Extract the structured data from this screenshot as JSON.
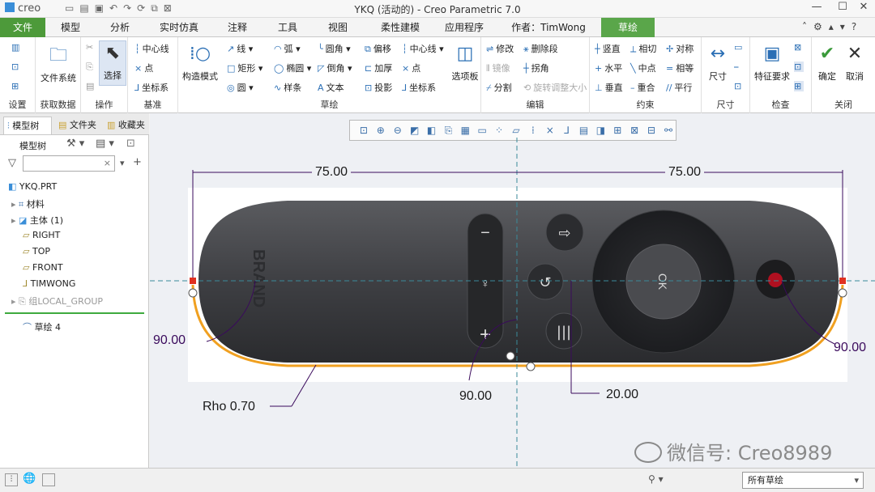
{
  "titlebar": {
    "logo": "creo",
    "title": "YKQ (活动的) - Creo Parametric 7.0",
    "minimize": "—",
    "restore": "☐",
    "close": "✕"
  },
  "tabs": [
    {
      "label": "文件"
    },
    {
      "label": "模型"
    },
    {
      "label": "分析"
    },
    {
      "label": "实时仿真"
    },
    {
      "label": "注释"
    },
    {
      "label": "工具"
    },
    {
      "label": "视图"
    },
    {
      "label": "柔性建模"
    },
    {
      "label": "应用程序"
    },
    {
      "label": "作者：TimWong"
    },
    {
      "label": "草绘"
    }
  ],
  "ribbon": {
    "setup": {
      "label": "设置"
    },
    "get_data": {
      "file_system": "文件系统",
      "label": "获取数据"
    },
    "operations": {
      "select": "选择",
      "label": "操作"
    },
    "datum": {
      "centerline": "中心线",
      "point": "点",
      "coord": "坐标系",
      "label": "基准"
    },
    "construction": "构造模式",
    "sketching": {
      "line": "线",
      "arc": "弧",
      "fillet": "圆角",
      "offset": "偏移",
      "centerline": "中心线",
      "rectangle": "矩形",
      "ellipse": "椭圆",
      "chamfer": "倒角",
      "thicken": "加厚",
      "point": "点",
      "circle": "圆",
      "spline": "样条",
      "text": "文本",
      "project": "投影",
      "coord": "坐标系",
      "palette": "选项板",
      "label": "草绘"
    },
    "editing": {
      "modify": "修改",
      "delete_segment": "删除段",
      "mirror": "镜像",
      "corner": "拐角",
      "divide": "分割",
      "rotate_resize": "旋转调整大小",
      "label": "编辑"
    },
    "constrain": {
      "vertical": "竖直",
      "tangent": "相切",
      "symmetric": "对称",
      "horizontal": "水平",
      "midpoint": "中点",
      "equal": "相等",
      "perpendicular": "垂直",
      "coincident": "重合",
      "parallel": "平行",
      "label": "约束"
    },
    "dimension": {
      "dim": "尺寸",
      "label": "尺寸"
    },
    "inspect": {
      "feature_req": "特征要求",
      "label": "检查"
    },
    "close": {
      "ok": "确定",
      "cancel": "取消",
      "label": "关闭"
    }
  },
  "panel": {
    "tabs": [
      "模型树",
      "文件夹",
      "收藏夹"
    ],
    "model_tree_label": "模型树",
    "tree": [
      {
        "label": "YKQ.PRT"
      },
      {
        "label": "材料"
      },
      {
        "label": "主体 (1)"
      },
      {
        "label": "RIGHT"
      },
      {
        "label": "TOP"
      },
      {
        "label": "FRONT"
      },
      {
        "label": "TIMWONG"
      },
      {
        "label": "组LOCAL_GROUP"
      },
      {
        "label": "草绘 4"
      }
    ]
  },
  "dimensions": {
    "left_75": "75.00",
    "right_75": "75.00",
    "left_90": "90.00",
    "right_90": "90.00",
    "bottom_90": "90.00",
    "offset_20": "20.00",
    "rho": "Rho 0.70"
  },
  "image": {
    "brand": "BRAND",
    "ok": "OK"
  },
  "watermark": "微信号: Creo8989",
  "status": {
    "filter": "所有草绘"
  },
  "colors": {
    "file_tab": "#4d9a3a",
    "sketch_line": "#f0a020",
    "dim_line": "#3a0a5c",
    "accent": "#2b6fb5"
  }
}
